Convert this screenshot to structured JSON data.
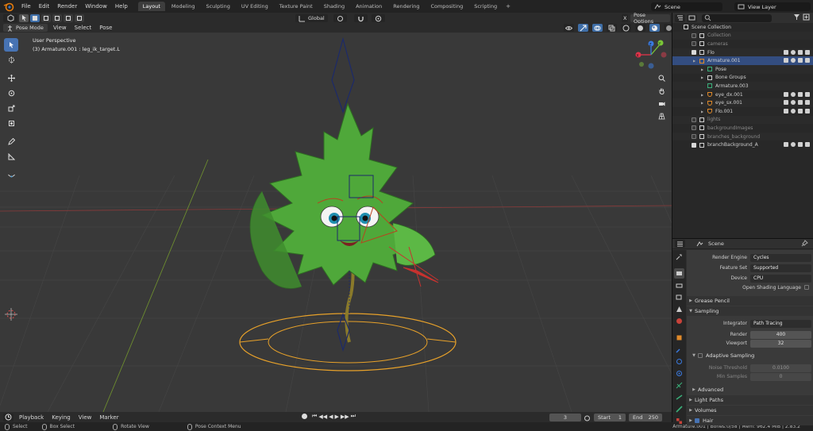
{
  "menu": {
    "items": [
      "File",
      "Edit",
      "Render",
      "Window",
      "Help"
    ],
    "workspaces": [
      "Layout",
      "Modeling",
      "Sculpting",
      "UV Editing",
      "Texture Paint",
      "Shading",
      "Animation",
      "Rendering",
      "Compositing",
      "Scripting"
    ],
    "active_workspace": "Layout",
    "add_workspace": "+",
    "scene_name": "Scene",
    "view_layer": "View Layer"
  },
  "viewport_header": {
    "mode": "Pose Mode",
    "menus": [
      "View",
      "Select",
      "Pose"
    ],
    "transform_orientation": "Global",
    "pose_options": "Pose Options",
    "close_x": "X"
  },
  "viewport": {
    "view_name": "User Perspective",
    "active_info": "(3) Armature.001 : leg_ik_target.L",
    "axis_x": "X",
    "axis_y": "Y",
    "axis_z": "Z"
  },
  "outliner": {
    "rows": [
      {
        "label": "Scene Collection",
        "indent": 0,
        "dim": false,
        "type": "collection",
        "selected": false,
        "checkbox": false,
        "restrict": false
      },
      {
        "label": "Collection",
        "indent": 1,
        "dim": true,
        "type": "collection",
        "selected": false,
        "checkbox": true,
        "checked": false,
        "restrict": false
      },
      {
        "label": "cameras",
        "indent": 1,
        "dim": true,
        "type": "collection",
        "selected": false,
        "checkbox": true,
        "checked": false,
        "restrict": false
      },
      {
        "label": "Flo",
        "indent": 1,
        "dim": false,
        "type": "collection",
        "selected": false,
        "checkbox": true,
        "checked": true,
        "restrict": true
      },
      {
        "label": "Armature.001",
        "indent": 2,
        "dim": false,
        "type": "armature",
        "selected": true,
        "checkbox": false,
        "restrict": true
      },
      {
        "label": "Pose",
        "indent": 3,
        "dim": false,
        "type": "pose",
        "selected": false,
        "checkbox": false,
        "restrict": false
      },
      {
        "label": "Bone Groups",
        "indent": 3,
        "dim": false,
        "type": "bonegroup",
        "selected": false,
        "checkbox": false,
        "restrict": false
      },
      {
        "label": "Armature.003",
        "indent": 3,
        "dim": false,
        "type": "armdata",
        "selected": false,
        "checkbox": false,
        "restrict": false
      },
      {
        "label": "eye_dx.001",
        "indent": 3,
        "dim": false,
        "type": "mesh",
        "selected": false,
        "checkbox": false,
        "restrict": true
      },
      {
        "label": "eye_sx.001",
        "indent": 3,
        "dim": false,
        "type": "mesh",
        "selected": false,
        "checkbox": false,
        "restrict": true
      },
      {
        "label": "Flo.001",
        "indent": 3,
        "dim": false,
        "type": "mesh",
        "selected": false,
        "checkbox": false,
        "restrict": true
      },
      {
        "label": "lights",
        "indent": 1,
        "dim": true,
        "type": "collection",
        "selected": false,
        "checkbox": true,
        "checked": false,
        "restrict": false
      },
      {
        "label": "backgroundImages",
        "indent": 1,
        "dim": true,
        "type": "collection",
        "selected": false,
        "checkbox": true,
        "checked": false,
        "restrict": false
      },
      {
        "label": "branches_background",
        "indent": 1,
        "dim": true,
        "type": "collection",
        "selected": false,
        "checkbox": true,
        "checked": false,
        "restrict": false
      },
      {
        "label": "branchBackground_A",
        "indent": 1,
        "dim": false,
        "type": "collection",
        "selected": false,
        "checkbox": true,
        "checked": true,
        "restrict": true
      }
    ]
  },
  "properties": {
    "header_title": "Scene",
    "render_engine_label": "Render Engine",
    "render_engine": "Cycles",
    "feature_set_label": "Feature Set",
    "feature_set": "Supported",
    "device_label": "Device",
    "device": "CPU",
    "osl_label": "Open Shading Language",
    "grease_pencil": "Grease Pencil",
    "sampling": "Sampling",
    "integrator_label": "Integrator",
    "integrator": "Path Tracing",
    "render_label": "Render",
    "render_samples": "400",
    "viewport_label": "Viewport",
    "viewport_samples": "32",
    "adaptive_sampling": "Adaptive Sampling",
    "noise_threshold_label": "Noise Threshold",
    "noise_threshold": "0.0100",
    "min_samples_label": "Min Samples",
    "min_samples": "0",
    "advanced": "Advanced",
    "light_paths": "Light Paths",
    "volumes": "Volumes",
    "hair": "Hair"
  },
  "timeline": {
    "menus": [
      "Playback",
      "Keying",
      "View",
      "Marker"
    ],
    "current_frame": "3",
    "start_label": "Start",
    "start": "1",
    "end_label": "End",
    "end": "250"
  },
  "statusbar": {
    "select": "Select",
    "box_select": "Box Select",
    "rotate_view": "Rotate View",
    "context_menu": "Pose Context Menu",
    "stats": "Armature.001 | Bones:0/58 | Mem: 962.4 MiB | 2.83.2"
  },
  "colors": {
    "accent": "#4773b3",
    "selected_row": "#334d80",
    "axis_x": "#e0344a",
    "axis_y": "#7ac637",
    "axis_z": "#3a7ae0",
    "leaf": "#4fa83a",
    "ik_circle": "#e7a12a"
  }
}
